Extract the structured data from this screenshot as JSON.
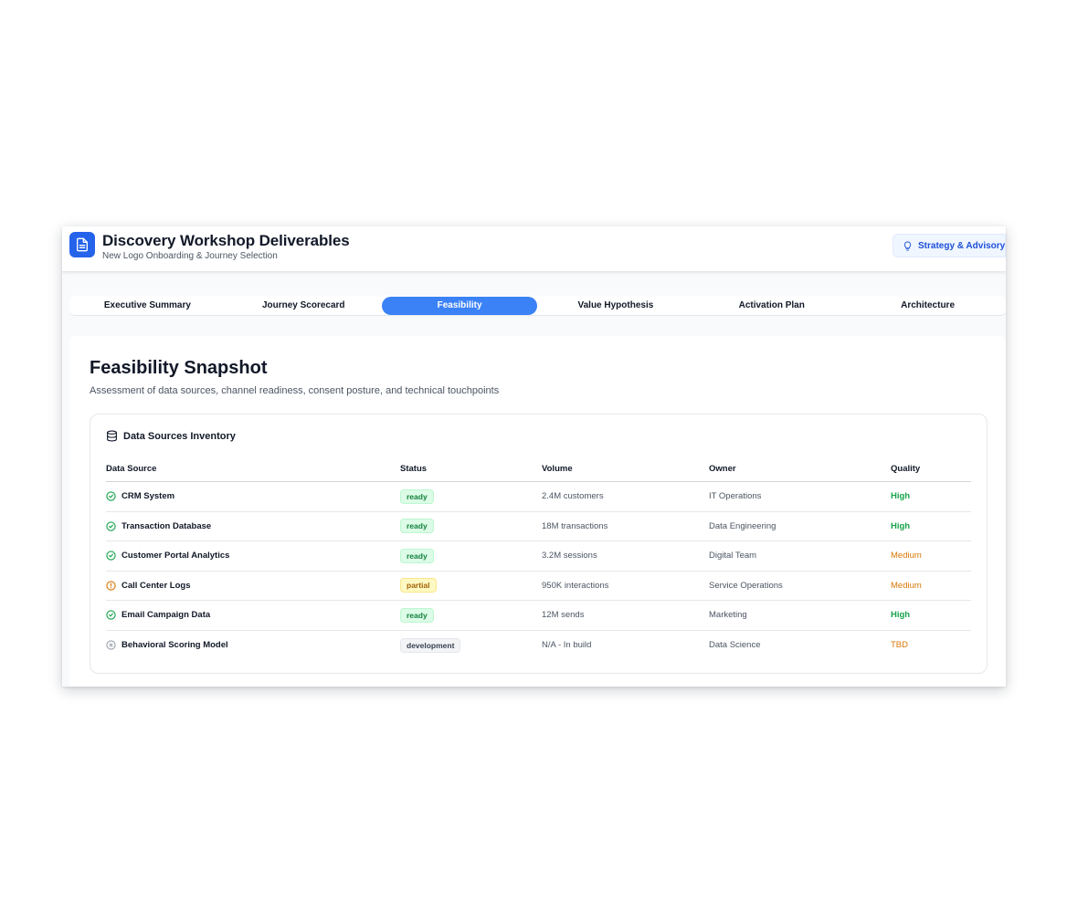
{
  "header": {
    "title": "Discovery Workshop Deliverables",
    "subtitle": "New Logo Onboarding & Journey Selection",
    "badge_label": "Strategy & Advisory",
    "brand_color": "#2563eb"
  },
  "tabs": [
    {
      "label": "Executive Summary",
      "active": false
    },
    {
      "label": "Journey Scorecard",
      "active": false
    },
    {
      "label": "Feasibility",
      "active": true
    },
    {
      "label": "Value Hypothesis",
      "active": false
    },
    {
      "label": "Activation Plan",
      "active": false
    },
    {
      "label": "Architecture",
      "active": false
    }
  ],
  "main": {
    "title": "Feasibility Snapshot",
    "description": "Assessment of data sources, channel readiness, consent posture, and technical touchpoints"
  },
  "inventory": {
    "title": "Data Sources Inventory",
    "title_icon": "database-icon",
    "columns": [
      "Data Source",
      "Status",
      "Volume",
      "Owner",
      "Quality"
    ],
    "rows": [
      {
        "name": "CRM System",
        "icon": "check-circle-icon",
        "status": "ready",
        "volume": "2.4M customers",
        "owner": "IT Operations",
        "quality": "High"
      },
      {
        "name": "Transaction Database",
        "icon": "check-circle-icon",
        "status": "ready",
        "volume": "18M transactions",
        "owner": "Data Engineering",
        "quality": "High"
      },
      {
        "name": "Customer Portal Analytics",
        "icon": "check-circle-icon",
        "status": "ready",
        "volume": "3.2M sessions",
        "owner": "Digital Team",
        "quality": "Medium"
      },
      {
        "name": "Call Center Logs",
        "icon": "alert-circle-icon",
        "status": "partial",
        "volume": "950K interactions",
        "owner": "Service Operations",
        "quality": "Medium"
      },
      {
        "name": "Email Campaign Data",
        "icon": "check-circle-icon",
        "status": "ready",
        "volume": "12M sends",
        "owner": "Marketing",
        "quality": "High"
      },
      {
        "name": "Behavioral Scoring Model",
        "icon": "x-circle-icon",
        "status": "development",
        "volume": "N/A - In build",
        "owner": "Data Science",
        "quality": "TBD"
      }
    ]
  }
}
